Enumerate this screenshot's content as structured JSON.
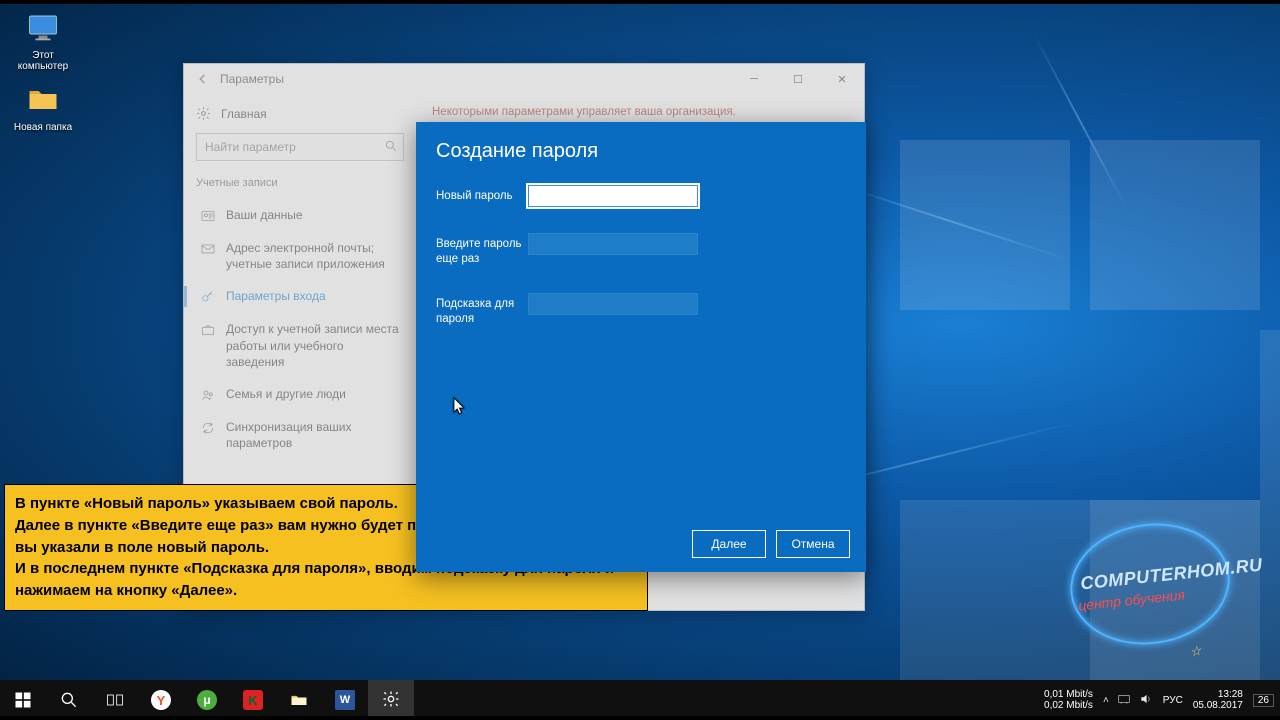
{
  "desktop": {
    "icons": [
      {
        "name": "this-pc",
        "label": "Этот\nкомпьютер"
      },
      {
        "name": "new-folder",
        "label": "Новая папка"
      }
    ]
  },
  "settings": {
    "back_tooltip": "Назад",
    "title": "Параметры",
    "home": "Главная",
    "search_placeholder": "Найти параметр",
    "category": "Учетные записи",
    "nav": [
      "Ваши данные",
      "Адрес электронной почты; учетные записи приложения",
      "Параметры входа",
      "Доступ к учетной записи места работы или учебного заведения",
      "Семья и другие люди",
      "Синхронизация ваших параметров"
    ],
    "active_index": 2,
    "org_banner": "Некоторыми параметрами управляет ваша организация."
  },
  "dialog": {
    "title": "Создание пароля",
    "new_password_label": "Новый пароль",
    "repeat_label": "Введите пароль еще раз",
    "hint_label": "Подсказка для пароля",
    "next": "Далее",
    "cancel": "Отмена"
  },
  "instruction": {
    "line1": "В пункте «Новый пароль» указываем свой пароль.",
    "line2": "Далее в пункте «Введите еще раз» вам нужно будет повторить тот же пароль, что вы указали в поле новый пароль.",
    "line3": "И в последнем пункте «Подсказка для пароля», вводим подсказку для пароля и нажимаем на кнопку «Далее»."
  },
  "logo": {
    "line1": "COMPUTERHOM.RU",
    "line2_left": "центр",
    "line2_right": "обучения"
  },
  "tray": {
    "net_up": "0,01 Mbit/s",
    "net_down": "0,02 Mbit/s",
    "lang": "РУС",
    "time": "13:28",
    "date": "05.08.2017",
    "day": "26"
  }
}
